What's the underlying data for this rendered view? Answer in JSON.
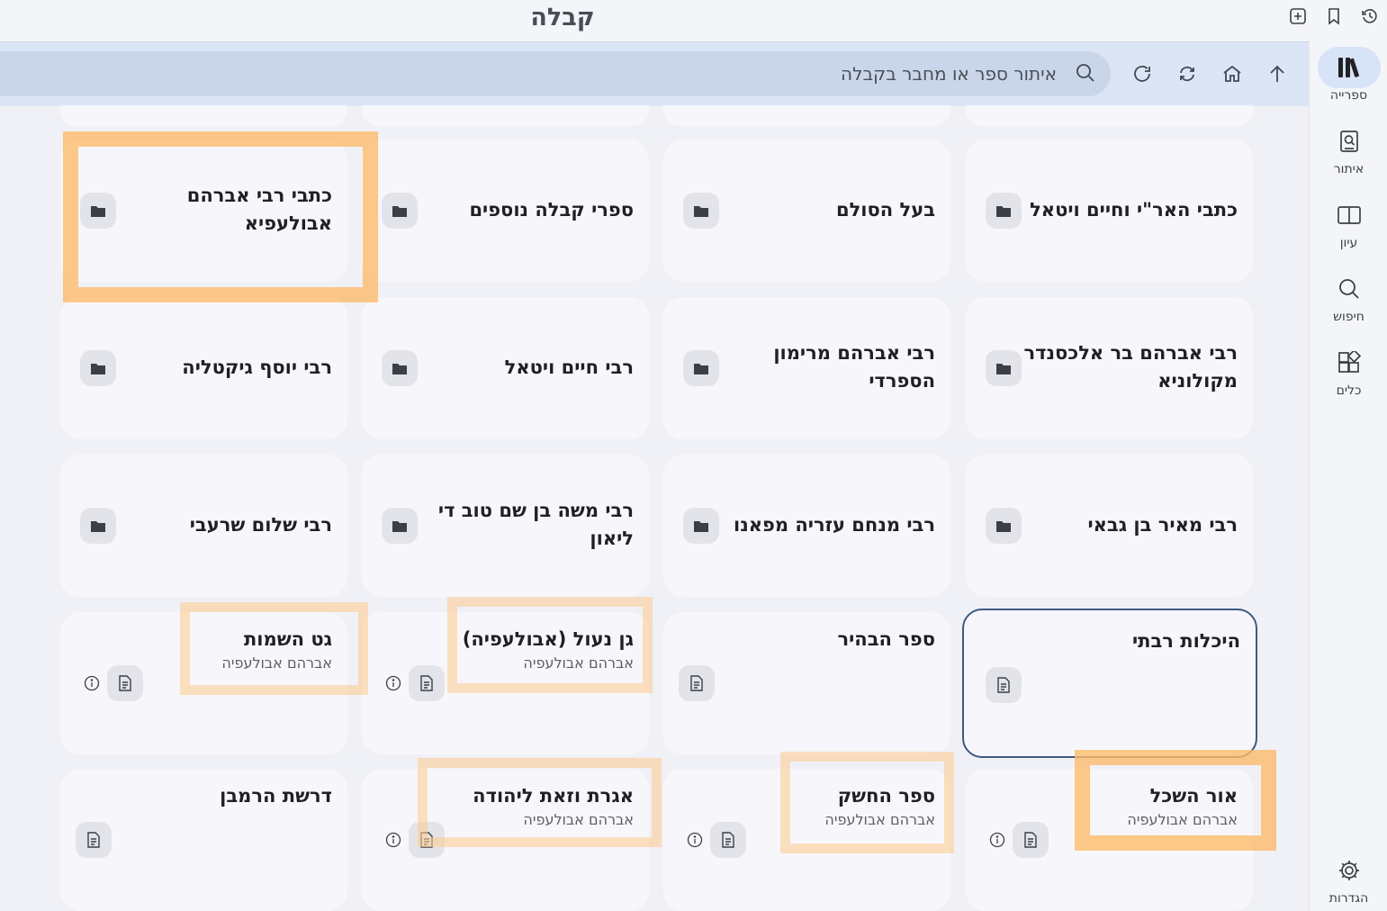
{
  "app": {
    "title": "קבלה"
  },
  "search": {
    "placeholder": "איתור ספר או מחבר בקבלה"
  },
  "toolbar": [
    "search-icon",
    "refresh-icon",
    "sync-icon",
    "home-icon",
    "arrow-up-icon"
  ],
  "window_icons": [
    "new-tab-icon",
    "bookmark-icon",
    "history-icon"
  ],
  "rail": {
    "items": [
      {
        "label": "ספרייה",
        "icon": "library-icon",
        "active": true
      },
      {
        "label": "איתור",
        "icon": "locate-icon"
      },
      {
        "label": "עיון",
        "icon": "book-open-icon"
      },
      {
        "label": "חיפוש",
        "icon": "search-icon"
      },
      {
        "label": "כלים",
        "icon": "tools-icon"
      }
    ],
    "settings_label": "הגדרות"
  },
  "categories": [
    "כתבי האר\"י וחיים ויטאל",
    "בעל הסולם",
    "ספרי קבלה נוספים",
    "כתבי רבי אברהם אבולעפיא",
    "רבי אברהם בר אלכסנדר מקולוניא",
    "רבי אברהם מרימון הספרדי",
    "רבי חיים ויטאל",
    "רבי יוסף גיקטליה",
    "רבי מאיר בן גבאי",
    "רבי מנחם עזריה מפאנו",
    "רבי משה בן שם טוב די ליאון",
    "רבי שלום שרעבי"
  ],
  "books": [
    {
      "title": "היכלות רבתי",
      "author": ""
    },
    {
      "title": "ספר הבהיר",
      "author": ""
    },
    {
      "title": "גן נעול (אבולעפיה)",
      "author": "אברהם אבולעפיה"
    },
    {
      "title": "גט השמות",
      "author": "אברהם אבולעפיה"
    },
    {
      "title": "אור השכל",
      "author": "אברהם אבולעפיה"
    },
    {
      "title": "ספר החשק",
      "author": "אברהם אבולעפיה"
    },
    {
      "title": "אגרת וזאת ליהודה",
      "author": "אברהם אבולעפיה"
    },
    {
      "title": "דרשת הרמבן",
      "author": ""
    }
  ]
}
